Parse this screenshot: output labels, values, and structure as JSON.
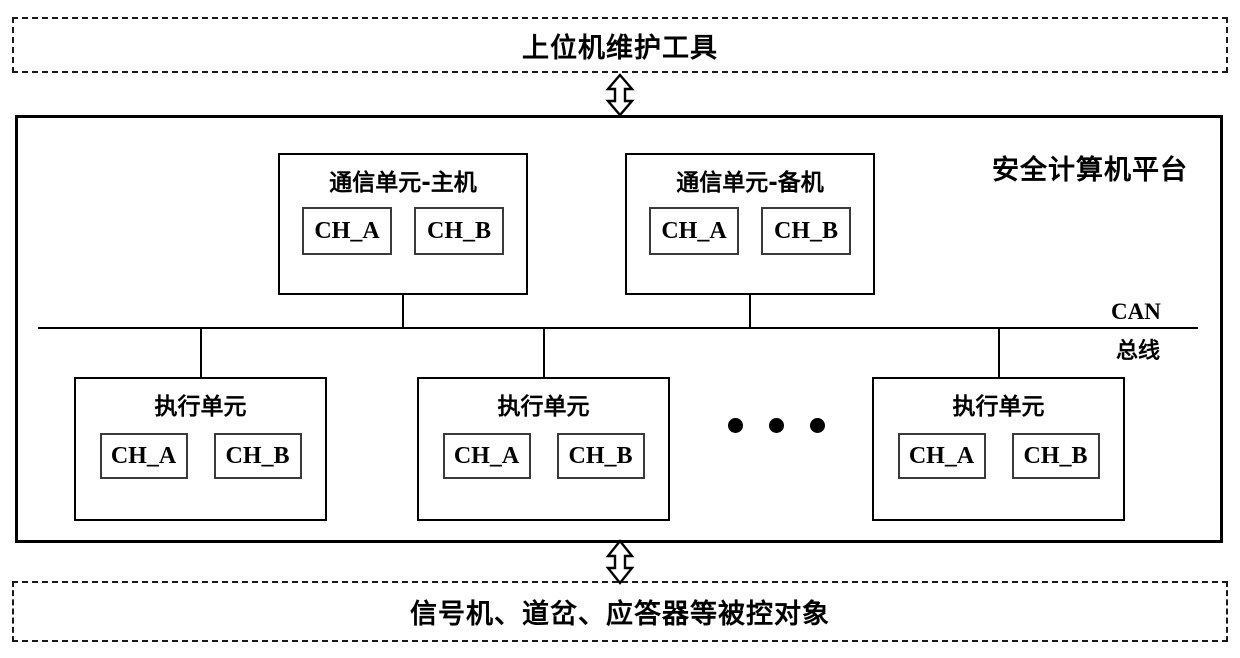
{
  "diagram": {
    "host_tool": {
      "label": "上位机维护工具"
    },
    "platform": {
      "title": "安全计算机平台",
      "bus": {
        "name": "CAN",
        "type": "总线"
      },
      "communication_units": [
        {
          "title": "通信单元-主机",
          "channels": [
            "CH_A",
            "CH_B"
          ]
        },
        {
          "title": "通信单元-备机",
          "channels": [
            "CH_A",
            "CH_B"
          ]
        }
      ],
      "execution_units": [
        {
          "title": "执行单元",
          "channels": [
            "CH_A",
            "CH_B"
          ]
        },
        {
          "title": "执行单元",
          "channels": [
            "CH_A",
            "CH_B"
          ]
        },
        {
          "title": "执行单元",
          "channels": [
            "CH_A",
            "CH_B"
          ]
        }
      ],
      "continuation": "•  •  •"
    },
    "field_objects": {
      "label": "信号机、道岔、应答器等被控对象"
    },
    "colors": {
      "line": "#000000",
      "text": "#000000",
      "background": "#ffffff",
      "inner_box_border": "#3a3a3a"
    }
  }
}
